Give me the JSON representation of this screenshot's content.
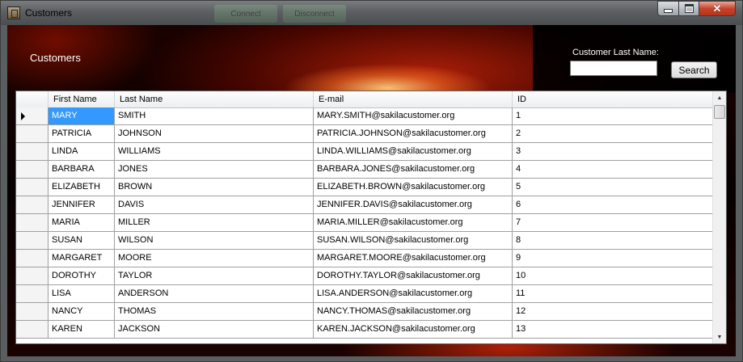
{
  "window": {
    "title": "Customers",
    "ghost_buttons": [
      "Connect",
      "Disconnect"
    ],
    "close_glyph": "✕"
  },
  "header": {
    "title": "Customers"
  },
  "search": {
    "label": "Customer Last Name:",
    "value": "",
    "button_label": "Search"
  },
  "grid": {
    "columns": [
      "First Name",
      "Last Name",
      "E-mail",
      "ID"
    ],
    "selected_row": 0,
    "selected_column": 0,
    "rows": [
      {
        "first": "MARY",
        "last": "SMITH",
        "email": "MARY.SMITH@sakilacustomer.org",
        "id": "1"
      },
      {
        "first": "PATRICIA",
        "last": "JOHNSON",
        "email": "PATRICIA.JOHNSON@sakilacustomer.org",
        "id": "2"
      },
      {
        "first": "LINDA",
        "last": "WILLIAMS",
        "email": "LINDA.WILLIAMS@sakilacustomer.org",
        "id": "3"
      },
      {
        "first": "BARBARA",
        "last": "JONES",
        "email": "BARBARA.JONES@sakilacustomer.org",
        "id": "4"
      },
      {
        "first": "ELIZABETH",
        "last": "BROWN",
        "email": "ELIZABETH.BROWN@sakilacustomer.org",
        "id": "5"
      },
      {
        "first": "JENNIFER",
        "last": "DAVIS",
        "email": "JENNIFER.DAVIS@sakilacustomer.org",
        "id": "6"
      },
      {
        "first": "MARIA",
        "last": "MILLER",
        "email": "MARIA.MILLER@sakilacustomer.org",
        "id": "7"
      },
      {
        "first": "SUSAN",
        "last": "WILSON",
        "email": "SUSAN.WILSON@sakilacustomer.org",
        "id": "8"
      },
      {
        "first": "MARGARET",
        "last": "MOORE",
        "email": "MARGARET.MOORE@sakilacustomer.org",
        "id": "9"
      },
      {
        "first": "DOROTHY",
        "last": "TAYLOR",
        "email": "DOROTHY.TAYLOR@sakilacustomer.org",
        "id": "10"
      },
      {
        "first": "LISA",
        "last": "ANDERSON",
        "email": "LISA.ANDERSON@sakilacustomer.org",
        "id": "11"
      },
      {
        "first": "NANCY",
        "last": "THOMAS",
        "email": "NANCY.THOMAS@sakilacustomer.org",
        "id": "12"
      },
      {
        "first": "KAREN",
        "last": "JACKSON",
        "email": "KAREN.JACKSON@sakilacustomer.org",
        "id": "13"
      }
    ]
  },
  "colors": {
    "selection": "#3399ff",
    "close_button": "#c7432b"
  }
}
